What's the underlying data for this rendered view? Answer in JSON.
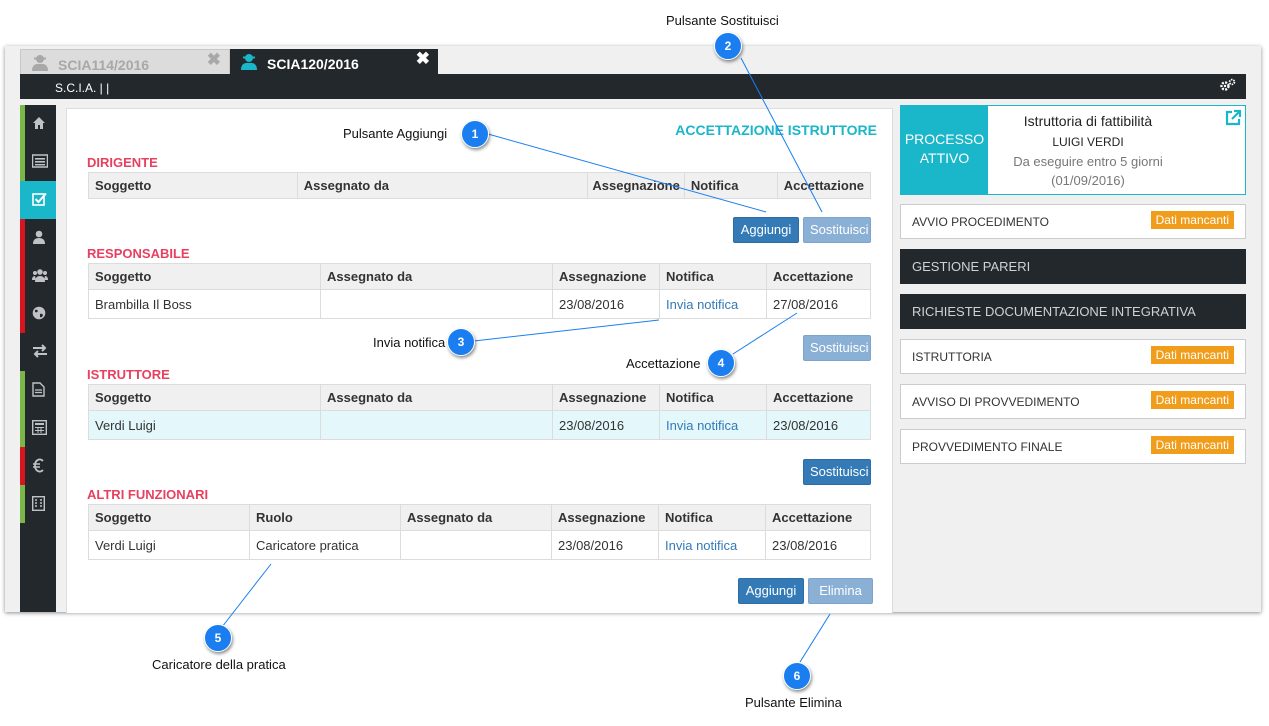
{
  "callouts": [
    {
      "num": "1",
      "label": "Pulsante  Aggiungi"
    },
    {
      "num": "2",
      "label": "Pulsante  Sostituisci"
    },
    {
      "num": "3",
      "label": "Invia notifica"
    },
    {
      "num": "4",
      "label": "Accettazione"
    },
    {
      "num": "5",
      "label": "Caricatore della pratica"
    },
    {
      "num": "6",
      "label": "Pulsante  Elimina"
    }
  ],
  "tabs": [
    {
      "label": "SCIA114/2016",
      "close": "✖",
      "icon": "user-icon"
    },
    {
      "label": "SCIA120/2016",
      "close": "✖",
      "icon": "user-icon"
    }
  ],
  "topbar": {
    "title": "S.C.I.A. | |",
    "icon": "gears-icon"
  },
  "sidebar": [
    {
      "icon": "home-icon",
      "stripe": "#7ab648"
    },
    {
      "icon": "list-icon",
      "stripe": "#7ab648"
    },
    {
      "icon": "check-square-icon",
      "stripe": "#1ab6c9",
      "active": true
    },
    {
      "icon": "user-icon",
      "stripe": "#d9141e"
    },
    {
      "icon": "users-icon",
      "stripe": "#d9141e"
    },
    {
      "icon": "globe-icon",
      "stripe": "#d9141e"
    },
    {
      "icon": "exchange-icon",
      "stripe": ""
    },
    {
      "icon": "file-icon",
      "stripe": "#7ab648"
    },
    {
      "icon": "calculator-icon",
      "stripe": "#7ab648"
    },
    {
      "icon": "euro-icon",
      "stripe": "#d9141e"
    },
    {
      "icon": "building-icon",
      "stripe": "#7ab648"
    }
  ],
  "main": {
    "heading": "ACCETTAZIONE ISTRUTTORE",
    "dirigente": {
      "title": "DIRIGENTE",
      "headers": [
        "Soggetto",
        "Assegnato da",
        "Assegnazione",
        "Notifica",
        "Accettazione"
      ],
      "add_label": "Aggiungi",
      "replace_label": "Sostituisci"
    },
    "responsabile": {
      "title": "RESPONSABILE",
      "headers": [
        "Soggetto",
        "Assegnato da",
        "Assegnazione",
        "Notifica",
        "Accettazione"
      ],
      "row": {
        "soggetto": "Brambilla Il Boss",
        "assegnato_da": "",
        "assegnazione": "23/08/2016",
        "notifica": "Invia notifica",
        "accettazione": "27/08/2016"
      },
      "replace_label": "Sostituisci"
    },
    "istruttore": {
      "title": "ISTRUTTORE",
      "headers": [
        "Soggetto",
        "Assegnato da",
        "Assegnazione",
        "Notifica",
        "Accettazione"
      ],
      "row": {
        "soggetto": "Verdi Luigi",
        "assegnato_da": "",
        "assegnazione": "23/08/2016",
        "notifica": "Invia notifica",
        "accettazione": "23/08/2016"
      },
      "replace_label": "Sostituisci"
    },
    "altri": {
      "title": "ALTRI FUNZIONARI",
      "headers": [
        "Soggetto",
        "Ruolo",
        "Assegnato da",
        "Assegnazione",
        "Notifica",
        "Accettazione"
      ],
      "row": {
        "soggetto": "Verdi Luigi",
        "ruolo": "Caricatore pratica",
        "assegnato_da": "",
        "assegnazione": "23/08/2016",
        "notifica": "Invia notifica",
        "accettazione": "23/08/2016"
      },
      "add_label": "Aggiungi",
      "delete_label": "Elimina"
    }
  },
  "right": {
    "processo": {
      "label_line1": "PROCESSO",
      "label_line2": "ATTIVO",
      "title": "Istruttoria di fattibilità",
      "person": "LUIGI VERDI",
      "deadline": "Da eseguire entro 5 giorni",
      "date": "(01/09/2016)",
      "icon": "external-link-icon"
    },
    "items": [
      {
        "label": "AVVIO PROCEDIMENTO",
        "badge": "Dati mancanti"
      },
      {
        "label": "GESTIONE PARERI"
      },
      {
        "label": "RICHIESTE DOCUMENTAZIONE INTEGRATIVA"
      },
      {
        "label": "ISTRUTTORIA",
        "badge": "Dati mancanti"
      },
      {
        "label": "AVVISO DI PROVVEDIMENTO",
        "badge": "Dati mancanti"
      },
      {
        "label": "PROVVEDIMENTO FINALE",
        "badge": "Dati mancanti"
      }
    ]
  },
  "colors": {
    "accent": "#1ab6c9",
    "section": "#e8405f",
    "button": "#337ab7",
    "badge": "#f19d1c",
    "dark": "#23282d",
    "callout": "#1a7ef0"
  }
}
